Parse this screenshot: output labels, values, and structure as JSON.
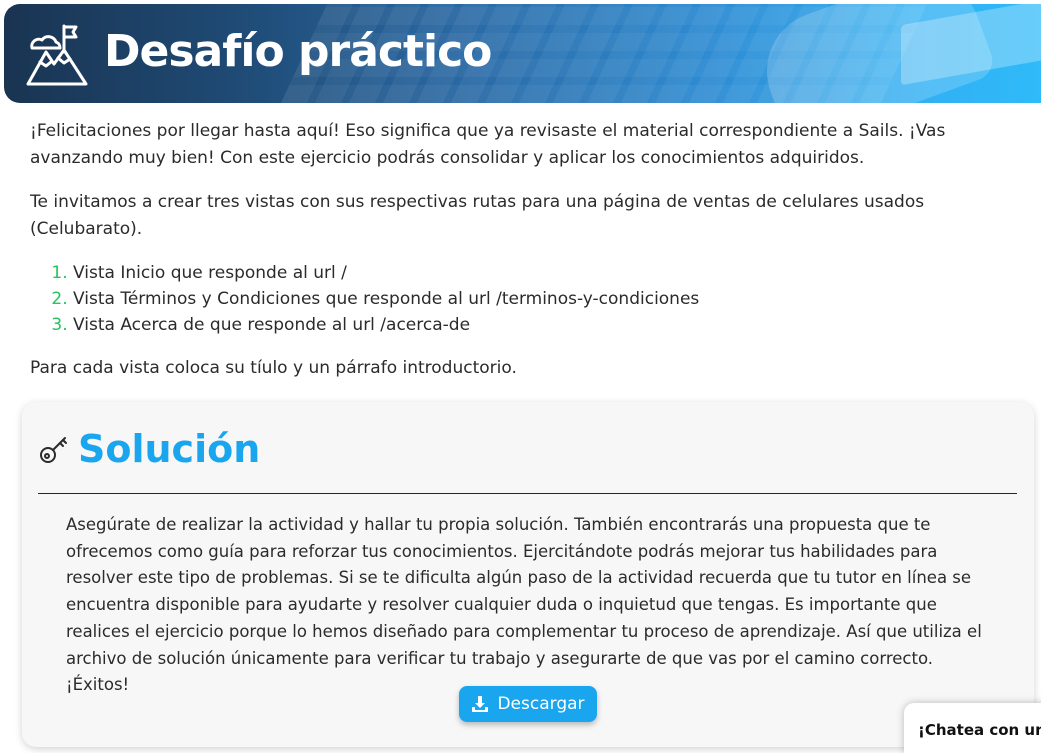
{
  "header": {
    "title": "Desafío práctico",
    "icon": "mountain-flag-icon"
  },
  "intro": {
    "p1": "¡Felicitaciones por llegar hasta aquí! Eso significa que ya revisaste el material correspondiente a Sails. ¡Vas avanzando muy bien! Con este ejercicio podrás consolidar y aplicar los conocimientos adquiridos.",
    "p2": "Te invitamos a crear tres vistas con sus respectivas rutas para una página de ventas de celulares usados (Celubarato).",
    "steps": [
      "Vista Inicio que responde al url /",
      "Vista Términos y Condiciones que responde al url /terminos-y-condiciones",
      "Vista Acerca de que responde al url /acerca-de"
    ],
    "p3": "Para cada vista coloca su tíulo y un párrafo introductorio."
  },
  "solution": {
    "title": "Solución",
    "icon": "key-icon",
    "text": "Asegúrate de realizar la actividad y hallar tu propia solución. También encontrarás una propuesta que te ofrecemos como guía para reforzar tus conocimientos. Ejercitándote podrás mejorar tus habilidades para resolver este tipo de problemas. Si se te dificulta algún paso de la actividad recuerda que tu tutor en línea se encuentra disponible para ayudarte y resolver cualquier duda o inquietud que tengas. Es importante que realices el ejercicio porque lo hemos diseñado para complementar tu proceso de aprendizaje. Así que utiliza el archivo de solución únicamente para verificar tu trabajo y asegurarte de que vas por el camino correcto. ¡Éxitos!",
    "download_label": "Descargar",
    "download_icon": "download-icon"
  },
  "chat": {
    "label": "¡Chatea con un"
  },
  "colors": {
    "accent": "#1aa6ef",
    "list_marker": "#22c55e",
    "banner_dark": "#1a3452"
  }
}
